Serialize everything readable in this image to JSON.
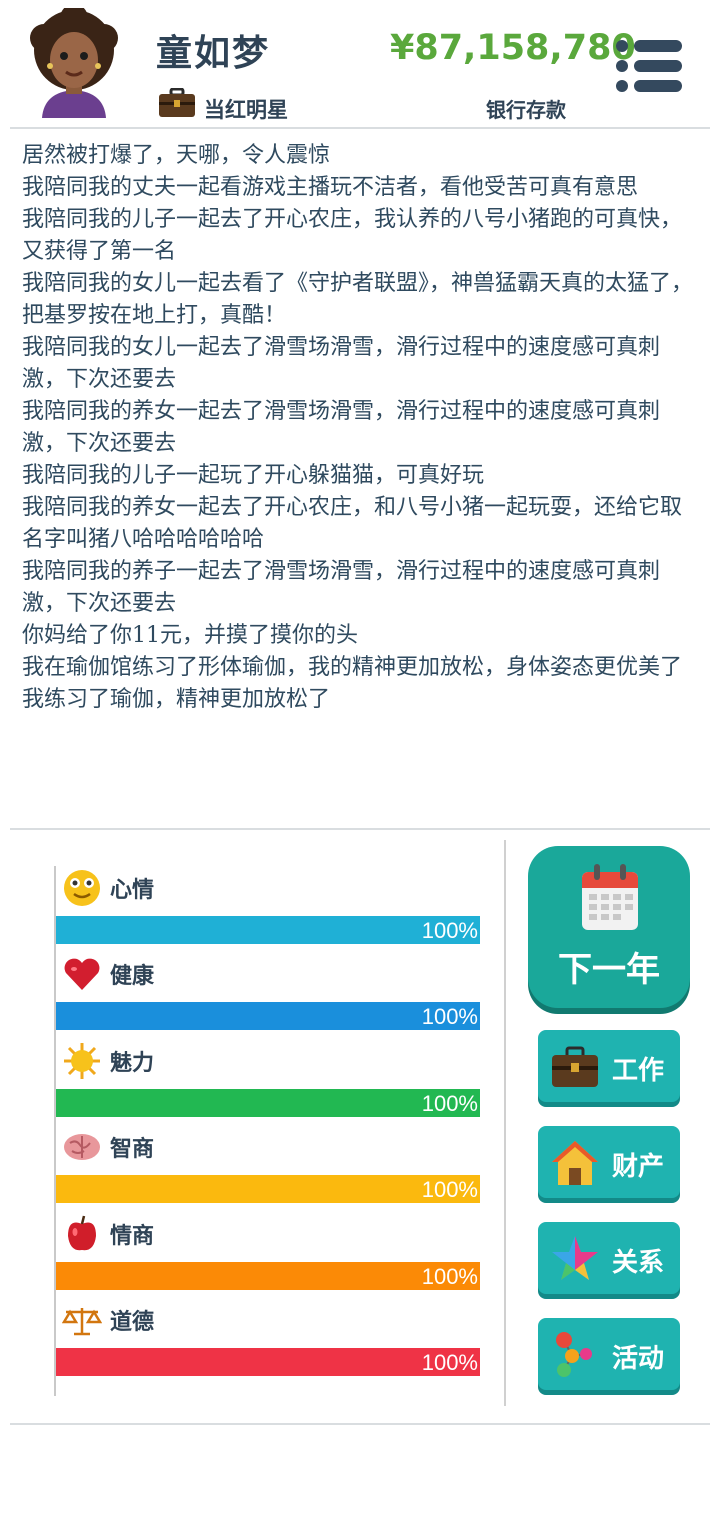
{
  "header": {
    "name": "童如梦",
    "job": "当红明星",
    "money": "¥87,158,780",
    "money_label": "银行存款",
    "icons": {
      "avatar": "avatar-woman",
      "job": "briefcase-icon",
      "menu": "menu-icon"
    }
  },
  "log": [
    "居然被打爆了，天哪，令人震惊",
    "我陪同我的丈夫一起看游戏主播玩不洁者，看他受苦可真有意思",
    "我陪同我的儿子一起去了开心农庄，我认养的八号小猪跑的可真快，又获得了第一名",
    "我陪同我的女儿一起去看了《守护者联盟》，神兽猛霸天真的太猛了，把基罗按在地上打，真酷！",
    "我陪同我的女儿一起去了滑雪场滑雪，滑行过程中的速度感可真刺激，下次还要去",
    "我陪同我的养女一起去了滑雪场滑雪，滑行过程中的速度感可真刺激，下次还要去",
    "我陪同我的儿子一起玩了开心躲猫猫，可真好玩",
    "我陪同我的养女一起去了开心农庄，和八号小猪一起玩耍，还给它取名字叫猪八哈哈哈哈哈哈",
    "我陪同我的养子一起去了滑雪场滑雪，滑行过程中的速度感可真刺激，下次还要去",
    "你妈给了你11元，并摸了摸你的头",
    "我在瑜伽馆练习了形体瑜伽，我的精神更加放松，身体姿态更优美了",
    "我练习了瑜伽，精神更加放松了"
  ],
  "stats": [
    {
      "label": "心情",
      "value": "100%",
      "fraction": 1.0,
      "color": "#1fb0d6",
      "icon": "smiley-icon"
    },
    {
      "label": "健康",
      "value": "100%",
      "fraction": 1.0,
      "color": "#1a8fdc",
      "icon": "heart-icon"
    },
    {
      "label": "魅力",
      "value": "100%",
      "fraction": 1.0,
      "color": "#22b852",
      "icon": "sun-icon"
    },
    {
      "label": "智商",
      "value": "100%",
      "fraction": 1.0,
      "color": "#fbb90e",
      "icon": "brain-icon"
    },
    {
      "label": "情商",
      "value": "100%",
      "fraction": 1.0,
      "color": "#fb8a06",
      "icon": "apple-icon"
    },
    {
      "label": "道德",
      "value": "100%",
      "fraction": 1.0,
      "color": "#ef3346",
      "icon": "scales-icon"
    }
  ],
  "actions": {
    "next_year": "下一年",
    "work": "工作",
    "property": "财产",
    "relations": "关系",
    "activities": "活动"
  },
  "colors": {
    "money": "#5aa83c",
    "button_teal": "#1fb3b0",
    "next_year_teal": "#1aa89a",
    "text_dark": "#2f4356"
  }
}
